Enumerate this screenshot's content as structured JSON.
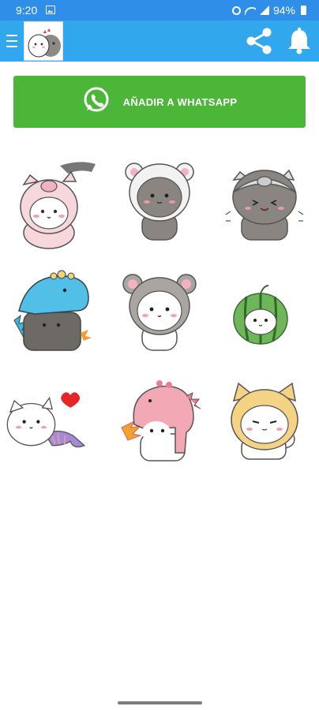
{
  "status_bar": {
    "time": "9:20",
    "battery_percent": "94%"
  },
  "app_bar": {
    "menu_icon": "hamburger-menu-icon",
    "thumbnail_icon": "sticker-pack-thumbnail",
    "share_icon": "share-icon",
    "bell_icon": "bell-icon",
    "background_color": "#31a7ee"
  },
  "whatsapp_button": {
    "label": "AÑADIR A WHATSAPP",
    "icon": "whatsapp-icon",
    "color": "#4bb638"
  },
  "stickers": [
    {
      "name": "white-cat-pink-pig-costume"
    },
    {
      "name": "gray-bear-in-bear-hood"
    },
    {
      "name": "gray-bear-pig-hood"
    },
    {
      "name": "gray-bear-blue-dino-costume"
    },
    {
      "name": "white-cat-gray-mouse-hood"
    },
    {
      "name": "watermelon-cat"
    },
    {
      "name": "mermaid-cat-with-heart"
    },
    {
      "name": "pink-dino-fire-breathing"
    },
    {
      "name": "yellow-cat-hood"
    }
  ]
}
